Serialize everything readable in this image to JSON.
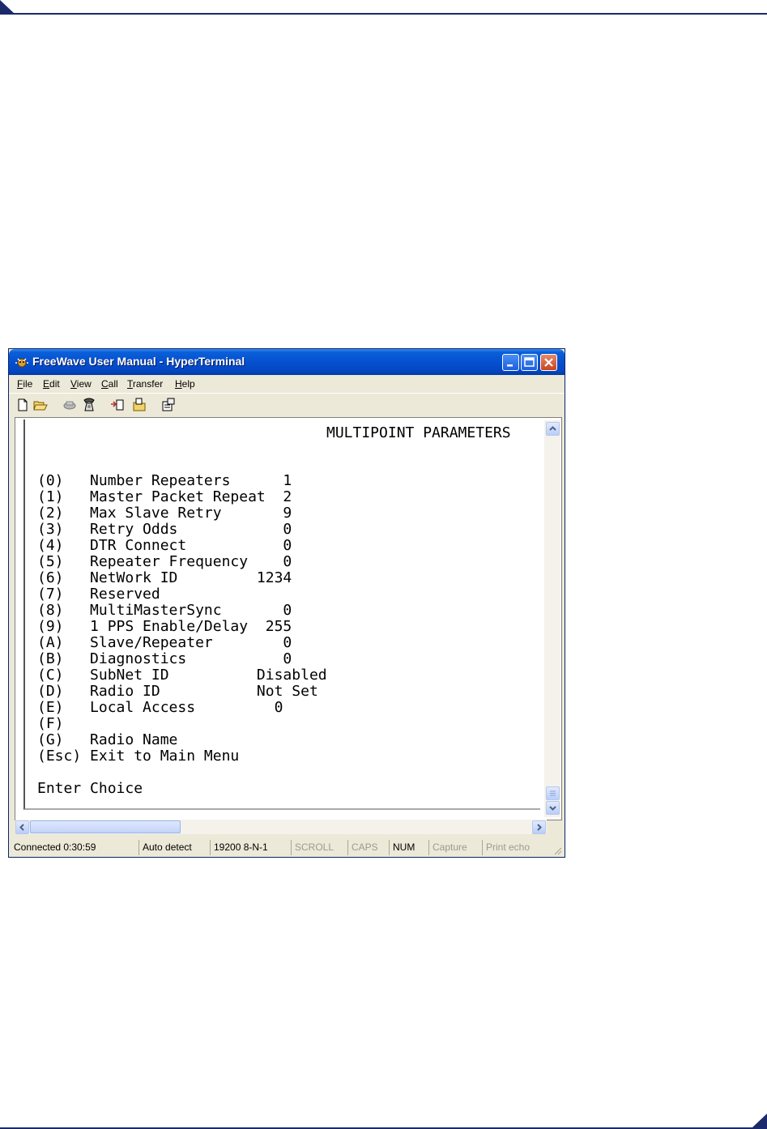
{
  "window": {
    "title": "FreeWave User Manual - HyperTerminal"
  },
  "menu": [
    {
      "label": "File",
      "ul": "F",
      "rest": "ile"
    },
    {
      "label": "Edit",
      "ul": "E",
      "rest": "dit"
    },
    {
      "label": "View",
      "ul": "V",
      "rest": "iew"
    },
    {
      "label": "Call",
      "ul": "C",
      "rest": "all"
    },
    {
      "label": "Transfer",
      "ul": "T",
      "rest": "ransfer"
    },
    {
      "label": "Help",
      "ul": "H",
      "rest": "elp"
    }
  ],
  "toolbar": {
    "icons": [
      "new-icon",
      "open-icon",
      "disconnect-icon",
      "dial-icon",
      "send-icon",
      "receive-icon",
      "properties-icon"
    ]
  },
  "terminal": {
    "header": "MULTIPOINT PARAMETERS",
    "lines": [
      "(0)   Number Repeaters      1",
      "(1)   Master Packet Repeat  2",
      "(2)   Max Slave Retry       9",
      "(3)   Retry Odds            0",
      "(4)   DTR Connect           0",
      "(5)   Repeater Frequency    0",
      "(6)   NetWork ID         1234",
      "(7)   Reserved",
      "(8)   MultiMasterSync       0",
      "(9)   1 PPS Enable/Delay  255",
      "(A)   Slave/Repeater        0",
      "(B)   Diagnostics           0",
      "(C)   SubNet ID          Disabled",
      "(D)   Radio ID           Not Set",
      "(E)   Local Access         0",
      "(F)",
      "(G)   Radio Name",
      "(Esc) Exit to Main Menu",
      "",
      "Enter Choice"
    ]
  },
  "status": {
    "connected": "Connected 0:30:59",
    "detect": "Auto detect",
    "port": "19200 8-N-1",
    "scroll": "SCROLL",
    "caps": "CAPS",
    "num": "NUM",
    "capture": "Capture",
    "print_echo": "Print echo"
  },
  "colors": {
    "title_blue": "#0550d0",
    "page_rule": "#1a2a6c"
  }
}
